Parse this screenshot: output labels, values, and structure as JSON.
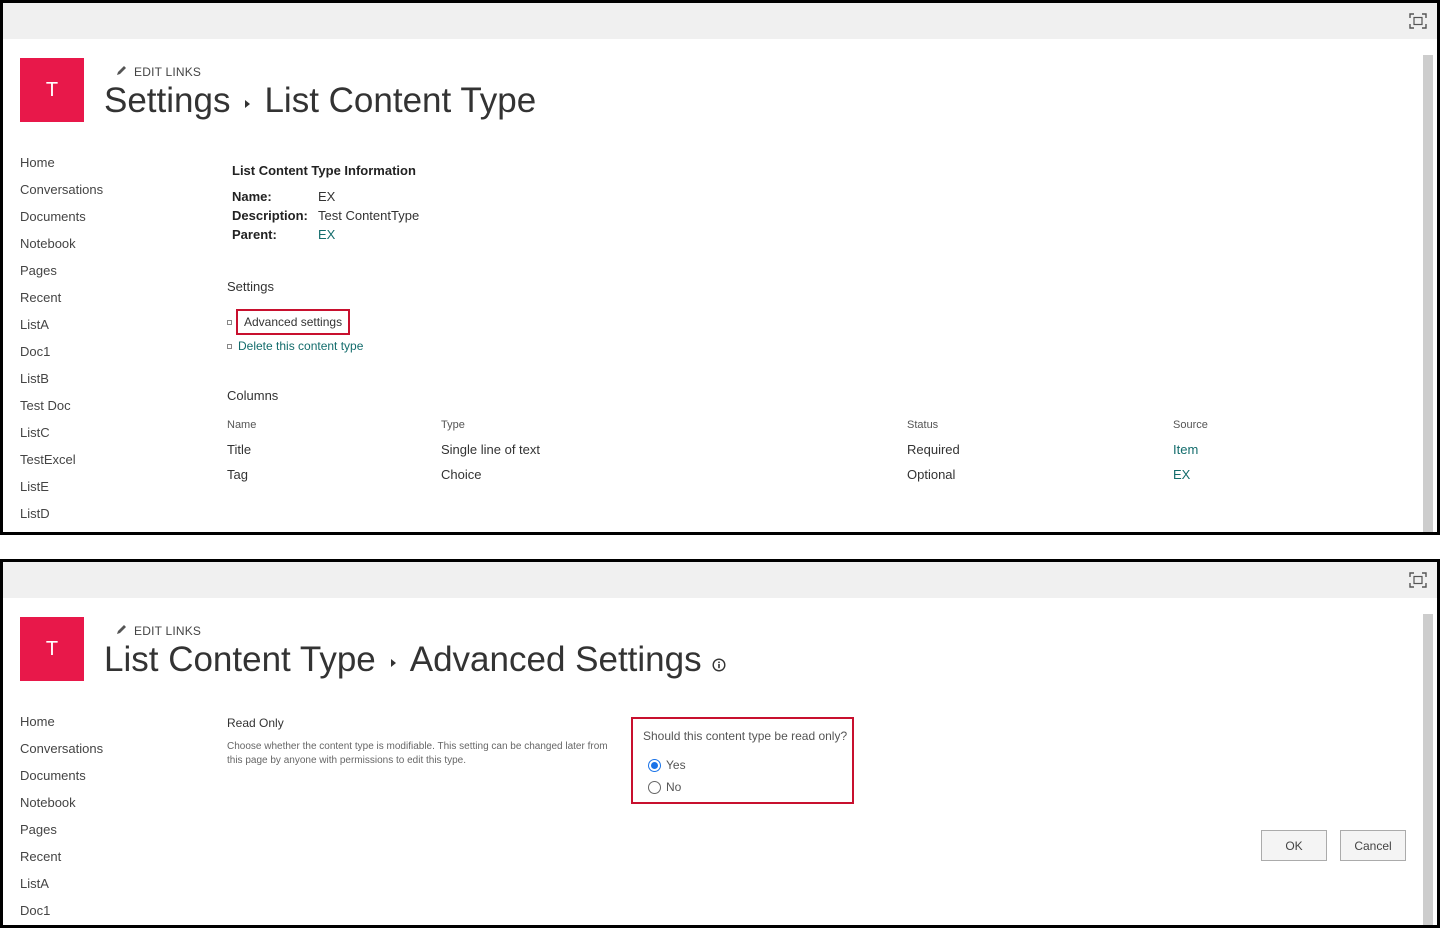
{
  "panel1": {
    "logo_letter": "T",
    "edit_links": "EDIT LINKS",
    "breadcrumb": [
      "Settings",
      "List Content Type"
    ],
    "nav": [
      "Home",
      "Conversations",
      "Documents",
      "Notebook",
      "Pages",
      "Recent",
      "ListA",
      "Doc1",
      "ListB",
      "Test Doc",
      "ListC",
      "TestExcel",
      "ListE",
      "ListD"
    ],
    "info": {
      "title": "List Content Type Information",
      "name_label": "Name:",
      "name_value": "EX",
      "description_label": "Description:",
      "description_value": "Test ContentType",
      "parent_label": "Parent:",
      "parent_value": "EX"
    },
    "settings": {
      "heading": "Settings",
      "advanced": "Advanced settings",
      "delete": "Delete this content type"
    },
    "columns": {
      "heading": "Columns",
      "headers": [
        "Name",
        "Type",
        "Status",
        "Source"
      ],
      "rows": [
        [
          "Title",
          "Single line of text",
          "Required",
          "Item"
        ],
        [
          "Tag",
          "Choice",
          "Optional",
          "EX"
        ]
      ]
    }
  },
  "panel2": {
    "logo_letter": "T",
    "edit_links": "EDIT LINKS",
    "breadcrumb": [
      "List Content Type",
      "Advanced Settings"
    ],
    "nav": [
      "Home",
      "Conversations",
      "Documents",
      "Notebook",
      "Pages",
      "Recent",
      "ListA",
      "Doc1"
    ],
    "read_only": {
      "title": "Read Only",
      "description": "Choose whether the content type is modifiable. This setting can be changed later from this page by anyone with permissions to edit this type.",
      "question": "Should this content type be read only?",
      "yes": "Yes",
      "no": "No",
      "selected": "Yes"
    },
    "buttons": {
      "ok": "OK",
      "cancel": "Cancel"
    }
  },
  "colors": {
    "logo_bg": "#e8184a",
    "link": "#136c6c",
    "highlight_border": "#c8102e",
    "radio_accent": "#1a73e8"
  },
  "icons": {
    "focus": "focus-mode-icon",
    "edit": "pencil-icon",
    "info": "info-icon"
  }
}
